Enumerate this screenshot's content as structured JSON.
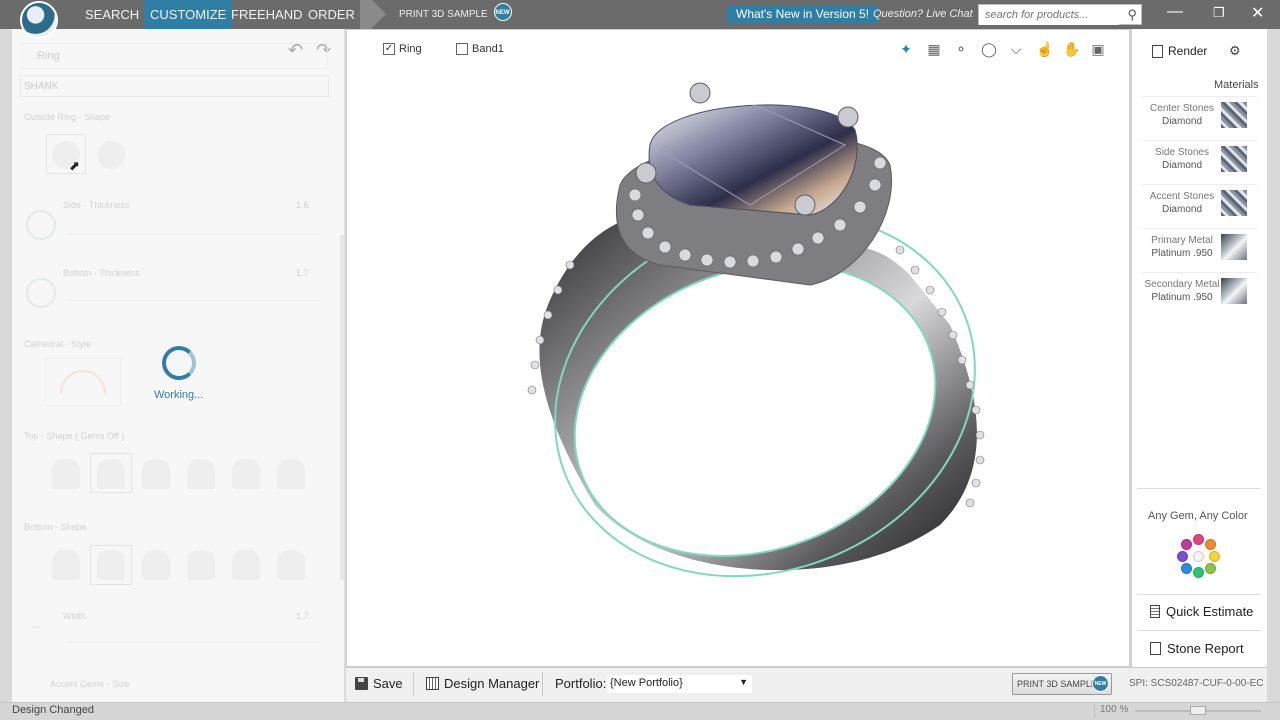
{
  "topnav": {
    "items": [
      "SEARCH",
      "CUSTOMIZE",
      "FREEHAND",
      "ORDER"
    ],
    "active": "CUSTOMIZE",
    "print_sample": "PRINT 3D SAMPLE",
    "new_badge": "NEW",
    "whats_new": "What's New in Version 5!",
    "question": "Question? Live Chat",
    "search_placeholder": "search for products...",
    "accent_color": "#2f7ea6"
  },
  "left_panel": {
    "ring_dropdown": "Ring",
    "shank_dropdown": "SHANK",
    "sections": {
      "outside": "Outside Ring - Shape",
      "side": "Side - Thickness",
      "side_val": "1.6",
      "bottom": "Bottom - Thickness",
      "bottom_val": "1.7",
      "cathedral": "Cathedral - Style",
      "top_shape": "Top - Shape ( Gems Off )",
      "bottom_shape": "Bottom - Shape",
      "width": "Width",
      "width_val": "1.7",
      "accent": "Accent Gems - Size"
    },
    "working": "Working..."
  },
  "viewport": {
    "checkboxes": [
      {
        "label": "Ring",
        "checked": true
      },
      {
        "label": "Band1",
        "checked": false
      }
    ],
    "tools": [
      "compass-icon",
      "grid-icon",
      "measure-icon",
      "ring-size-icon",
      "pin-icon",
      "finger-icon",
      "hand-icon",
      "image-icon"
    ]
  },
  "right_panel": {
    "render": "Render",
    "materials_title": "Materials",
    "materials": [
      {
        "name": "Center Stones",
        "value": "Diamond",
        "type": "diamond"
      },
      {
        "name": "Side Stones",
        "value": "Diamond",
        "type": "diamond"
      },
      {
        "name": "Accent Stones",
        "value": "Diamond",
        "type": "diamond"
      },
      {
        "name": "Primary Metal",
        "value": "Platinum .950",
        "type": "metal"
      },
      {
        "name": "Secondary Metal",
        "value": "Platinum .950",
        "type": "metal"
      }
    ],
    "any_gem": "Any Gem, Any Color",
    "quick_estimate": "Quick Estimate",
    "stone_report": "Stone Report"
  },
  "bottom_bar": {
    "save": "Save",
    "design_manager": "Design Manager",
    "portfolio_label": "Portfolio:",
    "portfolio_value": "{New Portfolio}",
    "print_sample": "PRINT 3D SAMPLE",
    "spi": "SPI:   SCS02487-CUF-0-00-EC"
  },
  "status_bar": {
    "status": "Design Changed",
    "zoom": "100 %",
    "zoom_level": 0.5
  }
}
